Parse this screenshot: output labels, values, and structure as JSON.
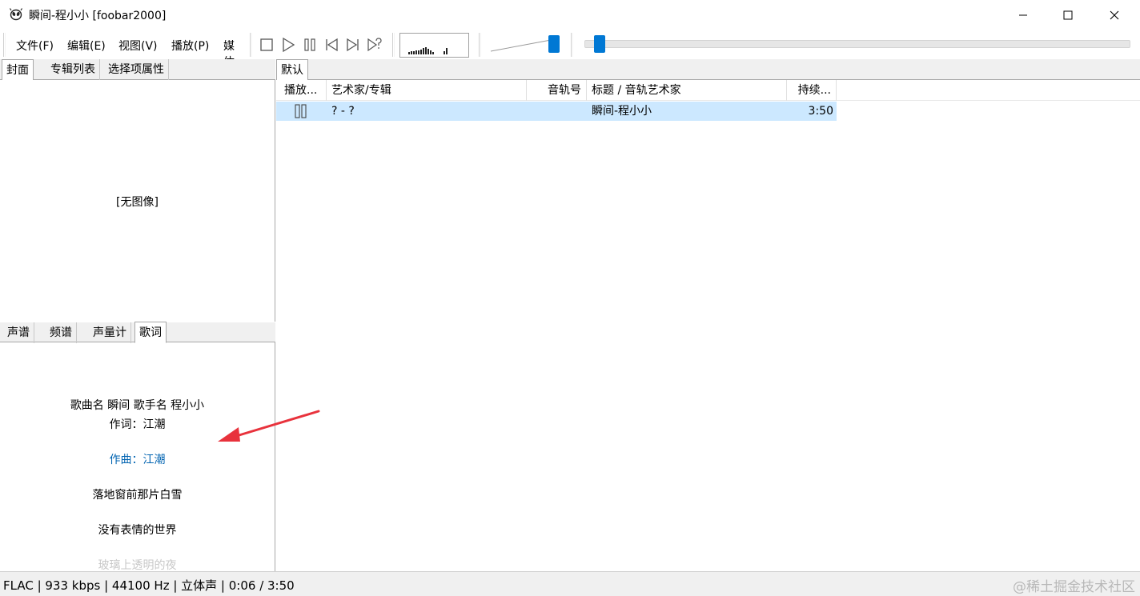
{
  "window": {
    "title": "瞬间-程小小  [foobar2000]"
  },
  "menu": {
    "items": [
      "文件(F)",
      "编辑(E)",
      "视图(V)",
      "播放(P)",
      "媒体库(L)"
    ]
  },
  "toolbar": {
    "buttons": [
      "stop-icon",
      "play-icon",
      "pause-icon",
      "previous-icon",
      "next-icon",
      "random-icon"
    ],
    "accent_color": "#0078d4"
  },
  "left_top_tabs": [
    "封面",
    "专辑列表",
    "选择项属性"
  ],
  "cover": {
    "placeholder": "[无图像]"
  },
  "left_bottom_tabs": [
    "声谱",
    "频谱",
    "声量计",
    "歌词"
  ],
  "lyrics": {
    "lines": [
      "歌曲名 瞬间 歌手名 程小小",
      "作词：江潮",
      "作曲：江潮",
      "落地窗前那片白雪",
      "没有表情的世界",
      "玻璃上透明的夜"
    ],
    "highlight_color": "#0063b1"
  },
  "playlist": {
    "tab": "默认",
    "columns": [
      "播放...",
      "艺术家/专辑",
      "音轨号",
      "标题 / 音轨艺术家",
      "持续..."
    ],
    "rows": [
      {
        "artist_album": "? - ?",
        "track_no": "",
        "title": "瞬间-程小小",
        "duration": "3:50"
      }
    ],
    "selected_color": "#cce8ff"
  },
  "status": {
    "text": "FLAC | 933 kbps | 44100 Hz | 立体声 | 0:06 / 3:50"
  },
  "watermark": "@稀土掘金技术社区"
}
